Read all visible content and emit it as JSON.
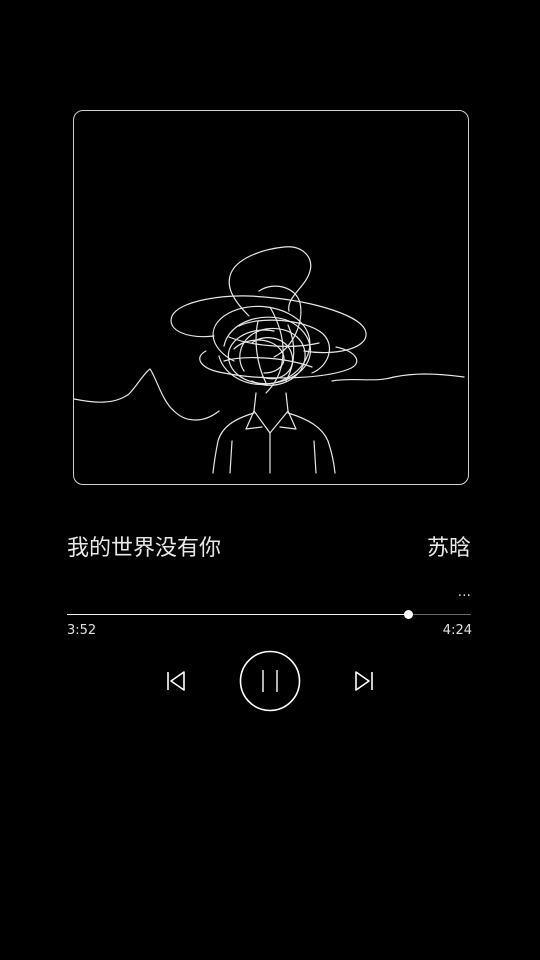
{
  "track": {
    "title": "我的世界没有你",
    "artist": "苏晗",
    "more_label": "..."
  },
  "playback": {
    "elapsed": "3:52",
    "total": "4:24",
    "progress": 0.845,
    "state": "playing"
  },
  "controls": {
    "previous_icon": "skip-previous-icon",
    "pause_icon": "pause-icon",
    "next_icon": "skip-next-icon"
  },
  "album_art": {
    "description_icon": "scribble-head-figure-icon"
  },
  "colors": {
    "background": "#000000",
    "foreground": "#ffffff",
    "track": "#6a6a6a"
  }
}
